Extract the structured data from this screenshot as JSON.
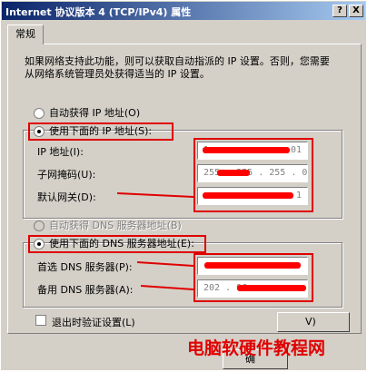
{
  "window": {
    "title": "Internet 协议版本 4 (TCP/IPv4) 属性",
    "help_label": "?",
    "close_label": "X"
  },
  "tabs": [
    {
      "label": "常规"
    }
  ],
  "description": "如果网络支持此功能，则可以获取自动指派的 IP 设置。否则，您需要从网络系统管理员处获得适当的 IP 设置。",
  "ip_section": {
    "auto_label": "自动获得 IP 地址(O)",
    "manual_label": "使用下面的 IP 地址(S):",
    "selected": "manual",
    "fields": [
      {
        "label": "IP 地址(I):",
        "value": "1",
        "value_end": "01"
      },
      {
        "label": "子网掩码(U):",
        "value": "255 . 255 . 255 . 0",
        "value_end": "0"
      },
      {
        "label": "默认网关(D):",
        "value": "",
        "value_end": "1"
      }
    ]
  },
  "dns_section": {
    "auto_label": "自动获得 DNS 服务器地址(B)",
    "manual_label": "使用下面的 DNS 服务器地址(E):",
    "selected": "manual",
    "fields": [
      {
        "label": "首选 DNS 服务器(P):",
        "value": ""
      },
      {
        "label": "备用 DNS 服务器(A):",
        "value": "202 . 96 ."
      }
    ]
  },
  "validate_on_exit": {
    "label": "退出时验证设置(L)",
    "checked": false
  },
  "buttons": {
    "ok_partial": "确",
    "advanced_partial": "V)"
  },
  "watermark": "电脑软硬件教程网",
  "colors": {
    "titlebar_start": "#0a246a",
    "titlebar_end": "#a6caf0",
    "face": "#d4d0c8",
    "annotation_red": "#e00000"
  }
}
